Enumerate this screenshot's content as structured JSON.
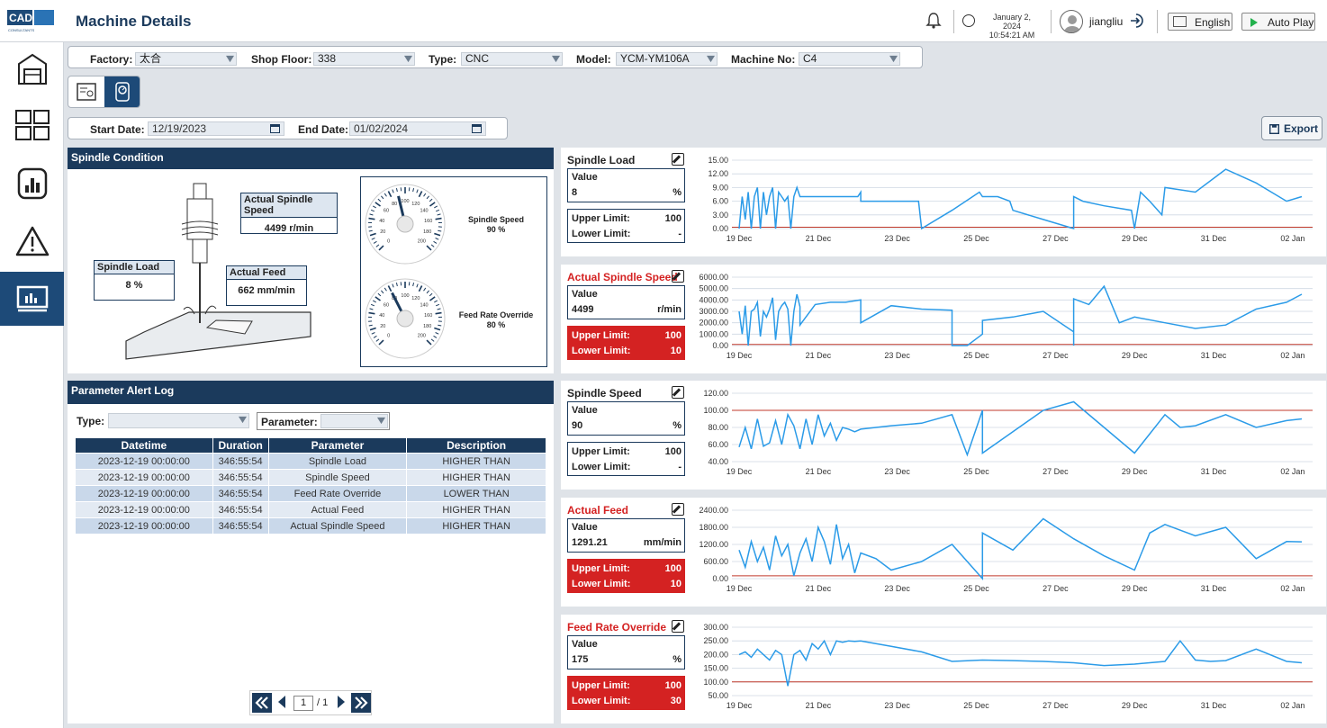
{
  "header": {
    "title": "Machine Details",
    "logo_text": "CAD-IT",
    "logo_sub": "CONSULTANTS",
    "date": "January 2, 2024",
    "time": "10:54:21 AM",
    "username": "jiangliu",
    "language": "English",
    "autoplay_label": "Auto Play"
  },
  "filters": {
    "factory_label": "Factory:",
    "factory_value": "太合",
    "shopfloor_label": "Shop Floor:",
    "shopfloor_value": "338",
    "type_label": "Type:",
    "type_value": "CNC",
    "model_label": "Model:",
    "model_value": "YCM-YM106A",
    "machine_label": "Machine No:",
    "machine_value": "C4"
  },
  "dates": {
    "start_label": "Start Date:",
    "start_value": "12/19/2023",
    "end_label": "End Date:",
    "end_value": "01/02/2024"
  },
  "export_label": "Export",
  "spindle_condition": {
    "title": "Spindle Condition",
    "actual_speed_label": "Actual Spindle Speed",
    "actual_speed_value": "4499 r/min",
    "load_label": "Spindle Load",
    "load_value": "8 %",
    "feed_label": "Actual Feed",
    "feed_value": "662 mm/min",
    "gauge1_label": "Spindle Speed",
    "gauge1_value": "90 %",
    "gauge1_level": 90,
    "gauge2_label": "Feed Rate Override",
    "gauge2_value": "80 %",
    "gauge2_level": 80,
    "gauge_ticks": [
      "0",
      "20",
      "40",
      "60",
      "80",
      "100",
      "120",
      "140",
      "160",
      "180",
      "200"
    ]
  },
  "alert_log": {
    "title": "Parameter Alert Log",
    "type_label": "Type:",
    "type_value": "",
    "parameter_label": "Parameter:",
    "parameter_value": "",
    "columns": [
      "Datetime",
      "Duration",
      "Parameter",
      "Description"
    ],
    "rows": [
      [
        "2023-12-19 00:00:00",
        "346:55:54",
        "Spindle Load",
        "HIGHER THAN"
      ],
      [
        "2023-12-19 00:00:00",
        "346:55:54",
        "Spindle Speed",
        "HIGHER THAN"
      ],
      [
        "2023-12-19 00:00:00",
        "346:55:54",
        "Feed Rate Override",
        "LOWER THAN"
      ],
      [
        "2023-12-19 00:00:00",
        "346:55:54",
        "Actual Feed",
        "HIGHER THAN"
      ],
      [
        "2023-12-19 00:00:00",
        "346:55:54",
        "Actual Spindle Speed",
        "HIGHER THAN"
      ]
    ],
    "page_current": "1",
    "page_total": "/ 1"
  },
  "colors": {
    "navy": "#1b3a5c",
    "alert_red": "#d42222",
    "line_blue": "#2b9be8",
    "limit_red": "#c0392b",
    "grid": "#cfd8e3"
  },
  "chart_data": [
    {
      "type": "line",
      "title": "Spindle Load",
      "title_alert": false,
      "value_label": "Value",
      "value": "8",
      "unit": "%",
      "upper_label": "Upper Limit:",
      "upper": "100",
      "lower_label": "Lower Limit:",
      "lower": "-",
      "limit_alert": false,
      "yticks": [
        "15.00",
        "12.00",
        "9.00",
        "6.00",
        "3.00",
        "0.00"
      ],
      "ylim": [
        0,
        15
      ],
      "limit_lines": [
        0.3
      ],
      "xticks": [
        "19 Dec",
        "21 Dec",
        "23 Dec",
        "25 Dec",
        "27 Dec",
        "29 Dec",
        "31 Dec",
        "02 Jan"
      ],
      "series": [
        {
          "x": [
            0,
            0.1,
            0.2,
            0.3,
            0.4,
            0.5,
            0.6,
            0.7,
            0.8,
            0.9,
            1.0,
            1.1,
            1.2,
            1.3,
            1.4,
            1.5,
            1.6,
            1.7,
            1.8,
            1.9,
            2.0,
            2.5,
            3.0,
            3.5,
            3.9,
            4.0,
            4.0,
            5.0,
            5.9,
            6.0,
            6.0,
            7.0,
            7.9,
            8.0,
            8.1,
            8.5,
            8.9,
            9.0,
            9.0,
            10.0,
            11.0,
            11.0,
            11.3,
            12.0,
            12.9,
            13.0,
            13.2,
            13.5,
            13.9,
            14.0,
            15.0,
            16.0,
            17.0,
            18.0,
            18.5
          ],
          "y": [
            0,
            7,
            2,
            8,
            0,
            7,
            9,
            0,
            8,
            3,
            7,
            9,
            0,
            8,
            7,
            6,
            7,
            0,
            7,
            9,
            7,
            7,
            7,
            7,
            7,
            8,
            6,
            6,
            6,
            0,
            0,
            4,
            8,
            7,
            7,
            7,
            6,
            4,
            4,
            2,
            0,
            7,
            6,
            5,
            4,
            0,
            8,
            6,
            3,
            9,
            8,
            13,
            10,
            6,
            7
          ]
        }
      ]
    },
    {
      "type": "line",
      "title": "Actual Spindle Speed",
      "title_alert": true,
      "value_label": "Value",
      "value": "4499",
      "unit": "r/min",
      "upper_label": "Upper Limit:",
      "upper": "100",
      "lower_label": "Lower Limit:",
      "lower": "10",
      "limit_alert": true,
      "yticks": [
        "6000.00",
        "5000.00",
        "4000.00",
        "3000.00",
        "2000.00",
        "1000.00",
        "0.00"
      ],
      "ylim": [
        0,
        6000
      ],
      "limit_lines": [
        100
      ],
      "xticks": [
        "19 Dec",
        "21 Dec",
        "23 Dec",
        "25 Dec",
        "27 Dec",
        "29 Dec",
        "31 Dec",
        "02 Jan"
      ],
      "series": [
        {
          "x": [
            0,
            0.1,
            0.2,
            0.3,
            0.4,
            0.5,
            0.6,
            0.7,
            0.8,
            0.9,
            1.0,
            1.1,
            1.2,
            1.3,
            1.4,
            1.5,
            1.6,
            1.7,
            1.8,
            1.9,
            2.0,
            2.0,
            2.5,
            3.0,
            3.5,
            4.0,
            4.0,
            5.0,
            6.0,
            7.0,
            7.0,
            7.5,
            8.0,
            8.0,
            9.0,
            10.0,
            11.0,
            11.0,
            11.0,
            11.5,
            12.0,
            12.5,
            13.0,
            14.0,
            15.0,
            16.0,
            17.0,
            18.0,
            18.5
          ],
          "y": [
            3000,
            1000,
            3500,
            0,
            3000,
            3200,
            3800,
            800,
            3000,
            2500,
            3200,
            4200,
            500,
            3000,
            3500,
            3800,
            3200,
            0,
            3000,
            4500,
            3400,
            1800,
            3600,
            3800,
            3800,
            4000,
            2000,
            3500,
            3200,
            3100,
            0,
            0,
            1000,
            2200,
            2500,
            3000,
            1200,
            0,
            4100,
            3600,
            5200,
            2000,
            2500,
            2000,
            1500,
            1800,
            3200,
            3800,
            4500
          ]
        }
      ]
    },
    {
      "type": "line",
      "title": "Spindle Speed",
      "title_alert": false,
      "value_label": "Value",
      "value": "90",
      "unit": "%",
      "upper_label": "Upper Limit:",
      "upper": "100",
      "lower_label": "Lower Limit:",
      "lower": "-",
      "limit_alert": false,
      "yticks": [
        "120.00",
        "100.00",
        "80.00",
        "60.00",
        "40.00"
      ],
      "ylim": [
        40,
        120
      ],
      "limit_lines": [
        100
      ],
      "xticks": [
        "19 Dec",
        "21 Dec",
        "23 Dec",
        "25 Dec",
        "27 Dec",
        "29 Dec",
        "31 Dec",
        "02 Jan"
      ],
      "series": [
        {
          "x": [
            0,
            0.2,
            0.4,
            0.6,
            0.8,
            1.0,
            1.2,
            1.4,
            1.6,
            1.8,
            2.0,
            2.2,
            2.4,
            2.6,
            2.8,
            3.0,
            3.2,
            3.4,
            3.6,
            3.8,
            4.0,
            5.0,
            6.0,
            7.0,
            7.5,
            8.0,
            8.0,
            9.0,
            10.0,
            11.0,
            12.0,
            13.0,
            14.0,
            14.5,
            15.0,
            16.0,
            17.0,
            18.0,
            18.5
          ],
          "y": [
            57,
            80,
            55,
            90,
            58,
            62,
            88,
            60,
            95,
            82,
            55,
            90,
            60,
            95,
            70,
            85,
            65,
            80,
            78,
            75,
            78,
            82,
            85,
            95,
            48,
            100,
            50,
            75,
            100,
            110,
            80,
            50,
            95,
            80,
            82,
            95,
            80,
            88,
            90
          ]
        }
      ]
    },
    {
      "type": "line",
      "title": "Actual Feed",
      "title_alert": true,
      "value_label": "Value",
      "value": "1291.21",
      "unit": "mm/min",
      "upper_label": "Upper Limit:",
      "upper": "100",
      "lower_label": "Lower Limit:",
      "lower": "10",
      "limit_alert": true,
      "yticks": [
        "2400.00",
        "1800.00",
        "1200.00",
        "600.00",
        "0.00"
      ],
      "ylim": [
        0,
        2400
      ],
      "limit_lines": [
        100
      ],
      "xticks": [
        "19 Dec",
        "21 Dec",
        "23 Dec",
        "25 Dec",
        "27 Dec",
        "29 Dec",
        "31 Dec",
        "02 Jan"
      ],
      "series": [
        {
          "x": [
            0,
            0.2,
            0.4,
            0.6,
            0.8,
            1.0,
            1.2,
            1.4,
            1.6,
            1.8,
            2.0,
            2.2,
            2.4,
            2.6,
            2.8,
            3.0,
            3.2,
            3.4,
            3.6,
            3.8,
            4.0,
            4.5,
            5.0,
            6.0,
            7.0,
            8.0,
            8.0,
            9.0,
            10.0,
            11.0,
            12.0,
            13.0,
            13.5,
            14.0,
            15.0,
            16.0,
            17.0,
            18.0,
            18.5
          ],
          "y": [
            1000,
            400,
            1300,
            600,
            1100,
            300,
            1500,
            800,
            1200,
            100,
            900,
            1400,
            600,
            1800,
            1300,
            500,
            1900,
            700,
            1200,
            200,
            900,
            700,
            300,
            600,
            1200,
            0,
            1600,
            1000,
            2100,
            1400,
            800,
            300,
            1600,
            1900,
            1500,
            1800,
            700,
            1300,
            1290
          ]
        }
      ]
    },
    {
      "type": "line",
      "title": "Feed Rate Override",
      "title_alert": true,
      "value_label": "Value",
      "value": "175",
      "unit": "%",
      "upper_label": "Upper Limit:",
      "upper": "100",
      "lower_label": "Lower Limit:",
      "lower": "30",
      "limit_alert": true,
      "yticks": [
        "300.00",
        "250.00",
        "200.00",
        "150.00",
        "100.00",
        "50.00"
      ],
      "ylim": [
        50,
        300
      ],
      "limit_lines": [
        100
      ],
      "xticks": [
        "19 Dec",
        "21 Dec",
        "23 Dec",
        "25 Dec",
        "27 Dec",
        "29 Dec",
        "31 Dec",
        "02 Jan"
      ],
      "series": [
        {
          "x": [
            0,
            0.2,
            0.4,
            0.6,
            0.8,
            1.0,
            1.2,
            1.4,
            1.6,
            1.8,
            2.0,
            2.2,
            2.4,
            2.6,
            2.8,
            3.0,
            3.2,
            3.4,
            3.6,
            3.8,
            4.0,
            4.5,
            5.0,
            6.0,
            7.0,
            8.0,
            9.0,
            10.0,
            11.0,
            12.0,
            13.0,
            14.0,
            14.5,
            15.0,
            15.5,
            16.0,
            17.0,
            18.0,
            18.5
          ],
          "y": [
            200,
            210,
            190,
            220,
            200,
            180,
            215,
            200,
            85,
            200,
            215,
            180,
            240,
            220,
            250,
            200,
            250,
            245,
            250,
            248,
            250,
            240,
            230,
            210,
            175,
            180,
            178,
            175,
            170,
            160,
            165,
            175,
            250,
            180,
            175,
            178,
            220,
            175,
            170
          ]
        }
      ]
    }
  ]
}
